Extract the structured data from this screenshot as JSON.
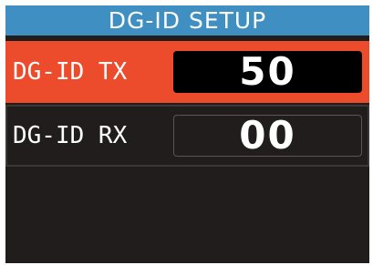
{
  "title": "DG-ID SETUP",
  "rows": [
    {
      "label": "DG-ID TX",
      "value": "50",
      "selected": true
    },
    {
      "label": "DG-ID RX",
      "value": "00",
      "selected": false
    }
  ],
  "colors": {
    "title_bar": "#3f8fc2",
    "selected_row": "#ec4b2c",
    "background": "#211d1d",
    "text": "#ffffff"
  }
}
